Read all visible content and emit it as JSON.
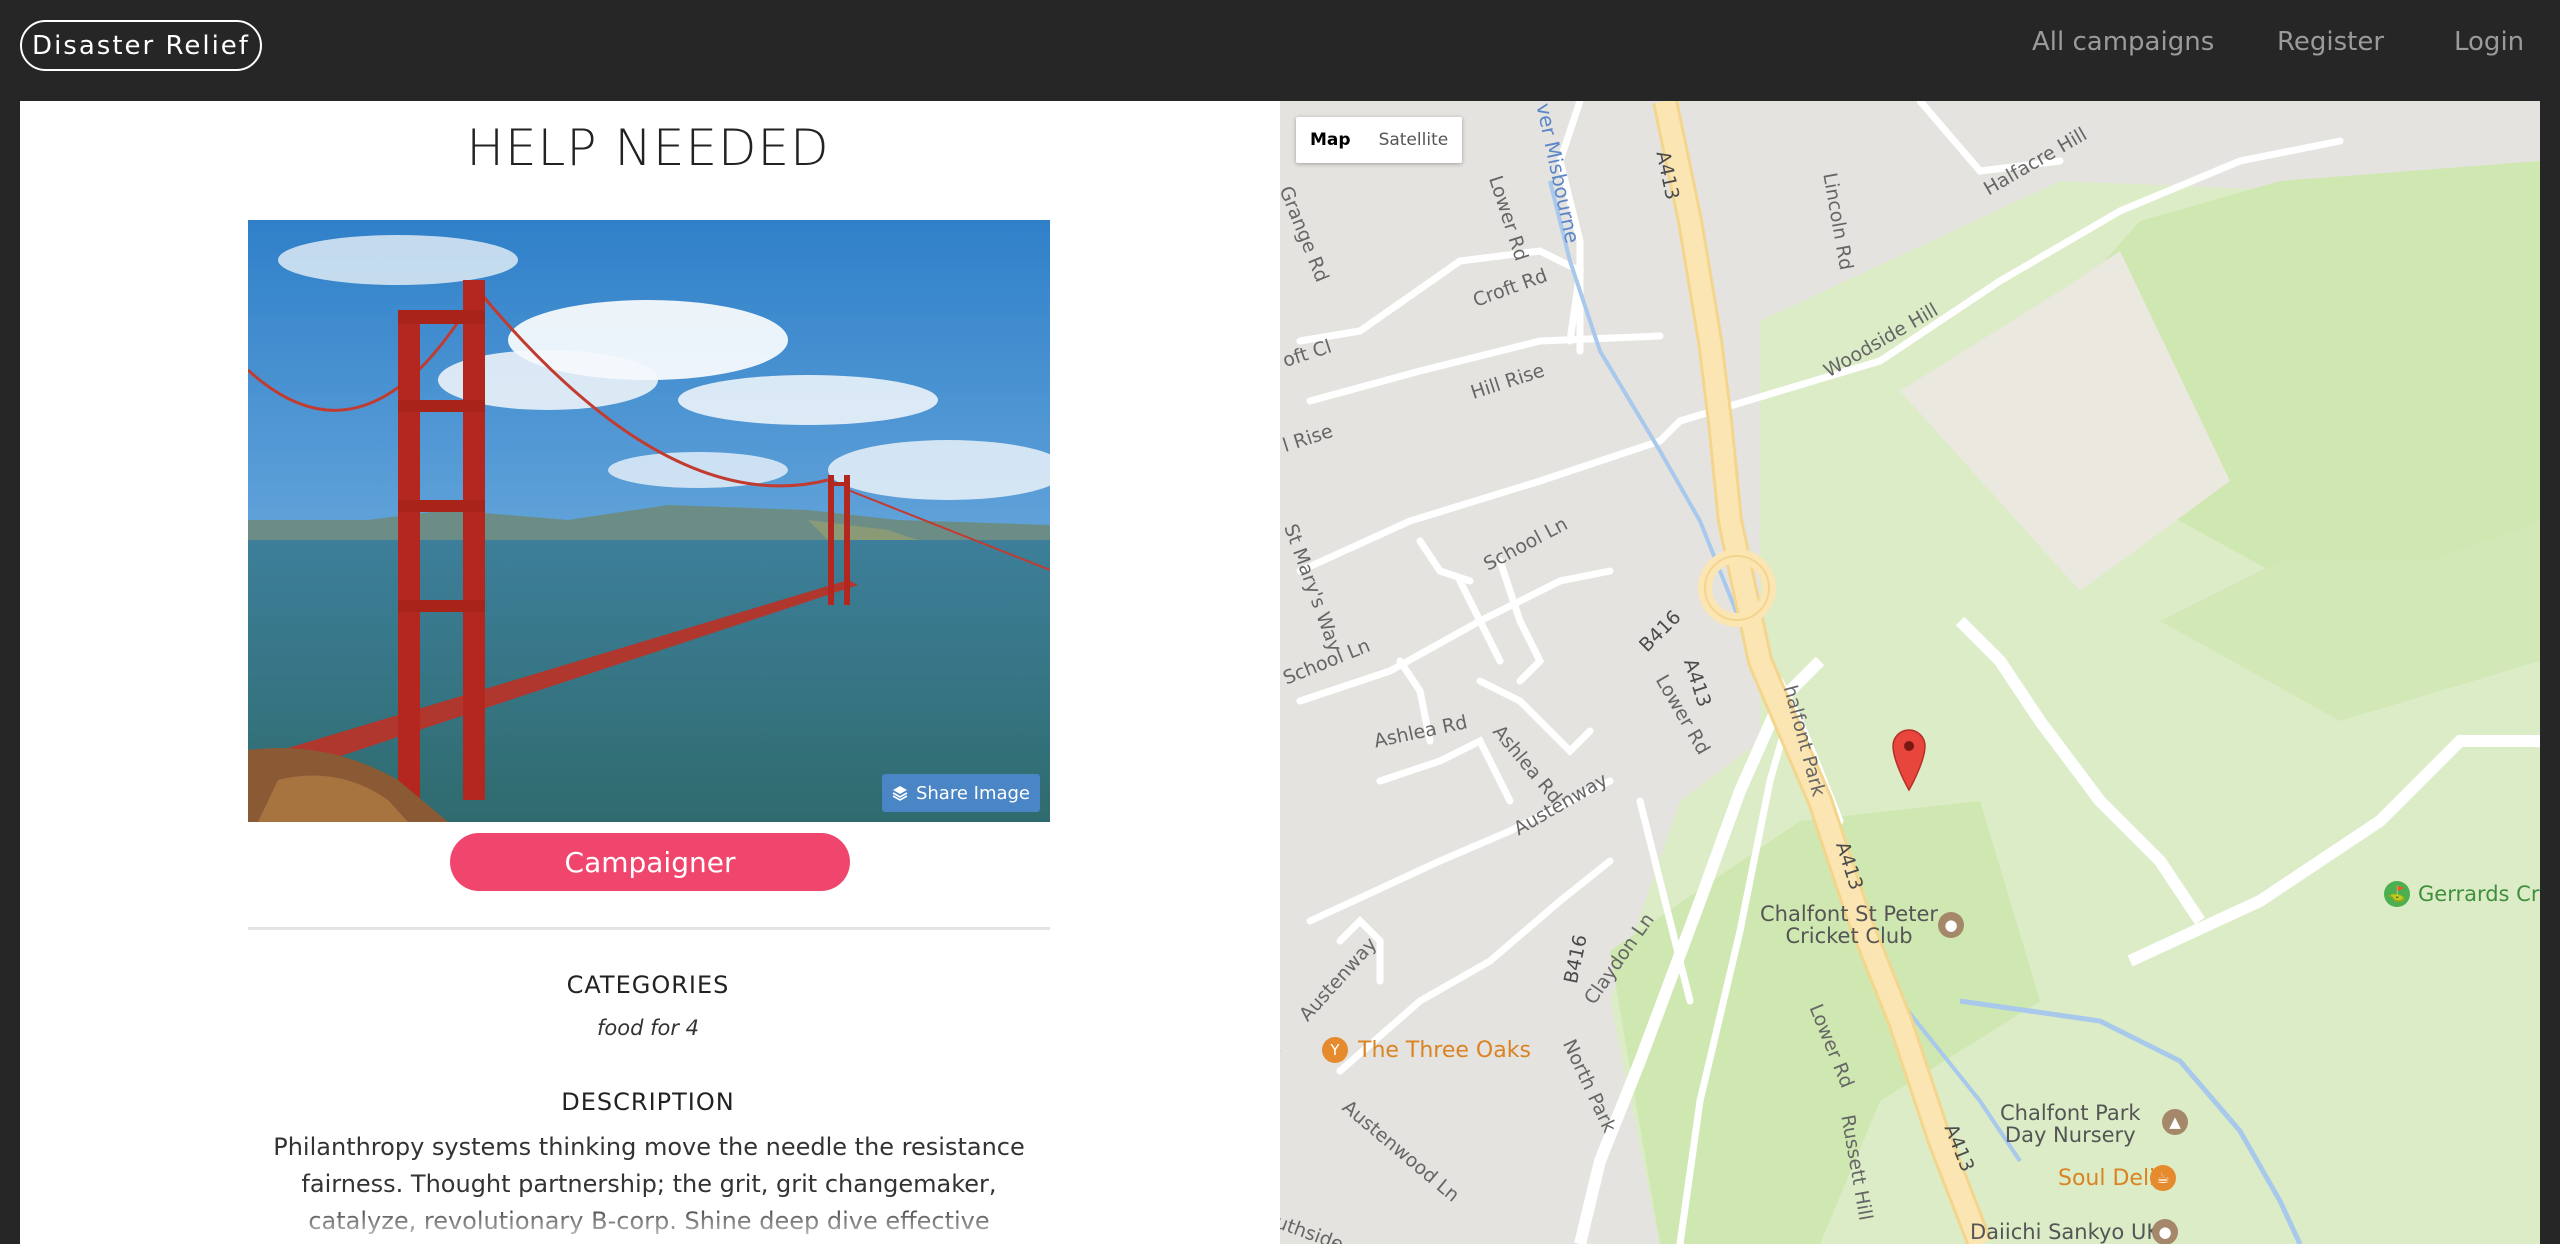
{
  "nav": {
    "brand": "Disaster Relief",
    "links": [
      "All campaigns",
      "Register",
      "Login"
    ]
  },
  "campaign": {
    "title": "HELP NEEDED",
    "share_label": "Share Image",
    "campaigner_label": "Campaigner",
    "categories_heading": "CATEGORIES",
    "categories_value": "food for 4",
    "description_heading": "DESCRIPTION",
    "description": "Philanthropy systems thinking move the needle the resistance fairness. Thought partnership; the grit, grit changemaker, catalyze, revolutionary B-corp. Shine deep dive effective"
  },
  "map": {
    "type_controls": [
      "Map",
      "Satellite"
    ],
    "labels": {
      "misbourne": "ver Misbourne",
      "a413": "A413",
      "b416": "B416",
      "lower_rd": "Lower Rd",
      "lincoln_rd": "Lincoln Rd",
      "halfacre_hill": "Halfacre Hill",
      "grange_rd": "Grange Rd",
      "croft_rd": "Croft Rd",
      "croft_cl": "oft Cl",
      "woodside_hill": "Woodside Hill",
      "hill_rise": "Hill Rise",
      "l_rise": "l Rise",
      "school_ln": "School Ln",
      "st_marys_way": "St Mary's Way",
      "ashlea_rd": "Ashlea Rd",
      "austenway": "Austenway",
      "chalfont_park": "halfont Park",
      "claydon_ln": "Claydon Ln",
      "north_park": "North Park",
      "austenwood_ln": "Austenwood Ln",
      "ln": "Ln",
      "russett_hill": "Russett Hill",
      "southside": "uthside",
      "cricket_club": "Chalfont St Peter\nCricket Club",
      "three_oaks": "The Three Oaks",
      "gerrards": "Gerrards Cro",
      "nursery": "Chalfont Park\nDay Nursery",
      "soul_deli": "Soul Deli",
      "daiichi": "Daiichi Sankyo UK"
    }
  },
  "colors": {
    "header_bg": "#262626",
    "accent_pink": "#f0466d",
    "share_blue": "#4a86c5",
    "map_park_green": "#cfe7b0",
    "road_yellow": "#fbe3a8",
    "marker_red": "#e8453c"
  }
}
